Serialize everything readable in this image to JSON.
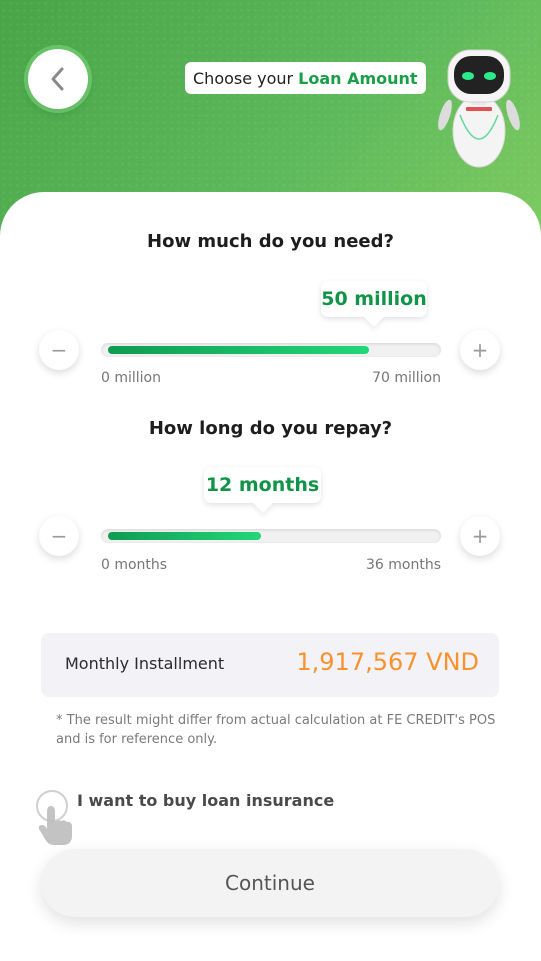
{
  "header": {
    "title_prefix": "Choose your",
    "title_accent": "Loan Amount",
    "colors": {
      "green": "#47a548",
      "accent_green": "#1a9e4a"
    }
  },
  "amount": {
    "question": "How much do you need?",
    "value_label": "50 million",
    "min_label": "0 million",
    "max_label": "70 million",
    "fill_fraction": 0.8
  },
  "duration": {
    "question": "How long do you repay?",
    "value_label": "12 months",
    "min_label": "0 months",
    "max_label": "36 months",
    "fill_fraction": 0.47
  },
  "installment": {
    "label": "Monthly Installment",
    "value": "1,917,567 VND",
    "value_color": "#f7922e"
  },
  "disclaimer": "* The result might differ from actual calculation at FE CREDIT's POS and is for reference only.",
  "insurance": {
    "label": "I want to buy loan insurance",
    "checked": false
  },
  "continue_label": "Continue",
  "icons": {
    "back": "chevron-left-icon",
    "minus": "minus-icon",
    "plus": "plus-icon",
    "tap_hint": "hand-pointer-icon",
    "mascot": "robot-mascot"
  },
  "glyphs": {
    "minus": "−",
    "plus": "+"
  }
}
